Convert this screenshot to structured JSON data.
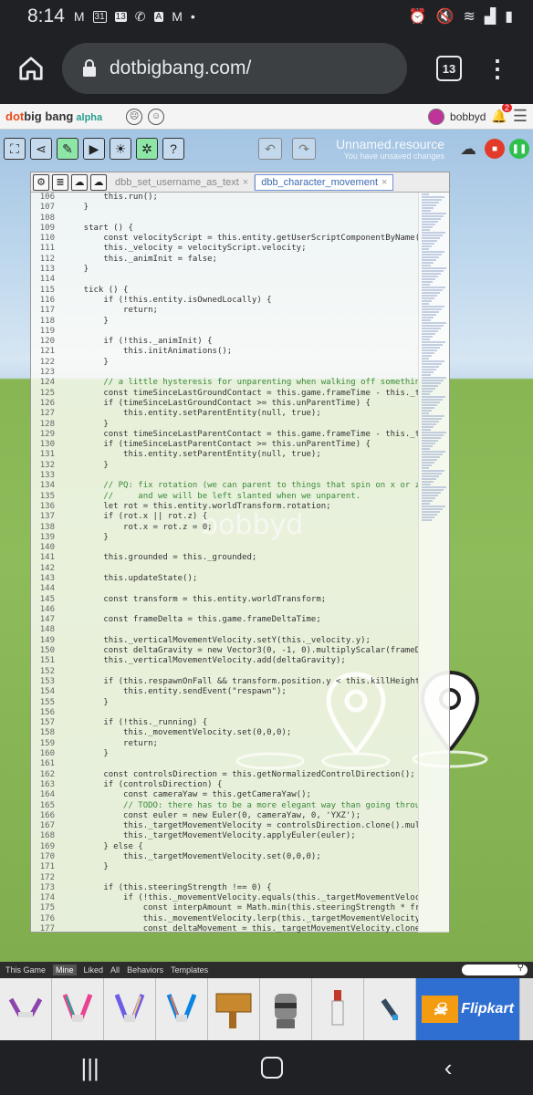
{
  "status": {
    "time": "8:14",
    "date_icon": "31",
    "cal2": "13"
  },
  "browser": {
    "url": "dotbigbang.com/",
    "tab_count": "13"
  },
  "app": {
    "logo_dot": "dot",
    "logo_main": "big bang",
    "logo_alpha": "alpha",
    "username": "bobbyd",
    "notif_count": "2",
    "resource_title": "Unnamed.resource",
    "resource_status": "You have unsaved changes"
  },
  "scene": {
    "player_label": "bobbyd"
  },
  "editor": {
    "tabs": [
      "dbb_set_username_as_text",
      "dbb_character_movement"
    ],
    "close_glyph": "×",
    "lines": [
      [
        "106",
        "        this.run();"
      ],
      [
        "107",
        "    }"
      ],
      [
        "108",
        ""
      ],
      [
        "109",
        "    start () {"
      ],
      [
        "110",
        "        const velocityScript = this.entity.getUserScriptComponentByName(\"dbb_"
      ],
      [
        "111",
        "        this._velocity = velocityScript.velocity;"
      ],
      [
        "112",
        "        this._animInit = false;"
      ],
      [
        "113",
        "    }"
      ],
      [
        "114",
        ""
      ],
      [
        "115",
        "    tick () {"
      ],
      [
        "116",
        "        if (!this.entity.isOwnedLocally) {"
      ],
      [
        "117",
        "            return;"
      ],
      [
        "118",
        "        }"
      ],
      [
        "119",
        ""
      ],
      [
        "120",
        "        if (!this._animInit) {"
      ],
      [
        "121",
        "            this.initAnimations();"
      ],
      [
        "122",
        "        }"
      ],
      [
        "123",
        ""
      ],
      [
        "124",
        "        // a little hysteresis for unparenting when walking off something to"
      ],
      [
        "125",
        "        const timeSinceLastGroundContact = this.game.frameTime - this._timeLa"
      ],
      [
        "126",
        "        if (timeSinceLastGroundContact >= this.unParentTime) {"
      ],
      [
        "127",
        "            this.entity.setParentEntity(null, true);"
      ],
      [
        "128",
        "        }"
      ],
      [
        "129",
        "        const timeSinceLastParentContact = this.game.frameTime - this._timeLa"
      ],
      [
        "130",
        "        if (timeSinceLastParentContact >= this.unParentTime) {"
      ],
      [
        "131",
        "            this.entity.setParentEntity(null, true);"
      ],
      [
        "132",
        "        }"
      ],
      [
        "133",
        ""
      ],
      [
        "134",
        "        // PQ: fix rotation (we can parent to things that spin on x or z, etc"
      ],
      [
        "135",
        "        //     and we will be left slanted when we unparent."
      ],
      [
        "136",
        "        let rot = this.entity.worldTransform.rotation;"
      ],
      [
        "137",
        "        if (rot.x || rot.z) {"
      ],
      [
        "138",
        "            rot.x = rot.z = 0;"
      ],
      [
        "139",
        "        }"
      ],
      [
        "140",
        ""
      ],
      [
        "141",
        "        this.grounded = this._grounded;"
      ],
      [
        "142",
        ""
      ],
      [
        "143",
        "        this.updateState();"
      ],
      [
        "144",
        ""
      ],
      [
        "145",
        "        const transform = this.entity.worldTransform;"
      ],
      [
        "146",
        ""
      ],
      [
        "147",
        "        const frameDelta = this.game.frameDeltaTime;"
      ],
      [
        "148",
        ""
      ],
      [
        "149",
        "        this._verticalMovementVelocity.setY(this._velocity.y);"
      ],
      [
        "150",
        "        const deltaGravity = new Vector3(0, -1, 0).multiplyScalar(frameDelta"
      ],
      [
        "151",
        "        this._verticalMovementVelocity.add(deltaGravity);"
      ],
      [
        "152",
        ""
      ],
      [
        "153",
        "        if (this.respawnOnFall && transform.position.y < this.killHeight) {"
      ],
      [
        "154",
        "            this.entity.sendEvent(\"respawn\");"
      ],
      [
        "155",
        "        }"
      ],
      [
        "156",
        ""
      ],
      [
        "157",
        "        if (!this._running) {"
      ],
      [
        "158",
        "            this._movementVelocity.set(0,0,0);"
      ],
      [
        "159",
        "            return;"
      ],
      [
        "160",
        "        }"
      ],
      [
        "161",
        ""
      ],
      [
        "162",
        "        const controlsDirection = this.getNormalizedControlDirection();"
      ],
      [
        "163",
        "        if (controlsDirection) {"
      ],
      [
        "164",
        "            const cameraYaw = this.getCameraYaw();"
      ],
      [
        "165",
        "            // TODO: there has to be a more elegant way than going through th"
      ],
      [
        "166",
        "            const euler = new Euler(0, cameraYaw, 0, 'YXZ');"
      ],
      [
        "167",
        "            this._targetMovementVelocity = controlsDirection.clone().multiply"
      ],
      [
        "168",
        "            this._targetMovementVelocity.applyEuler(euler);"
      ],
      [
        "169",
        "        } else {"
      ],
      [
        "170",
        "            this._targetMovementVelocity.set(0,0,0);"
      ],
      [
        "171",
        "        }"
      ],
      [
        "172",
        ""
      ],
      [
        "173",
        "        if (this.steeringStrength !== 0) {"
      ],
      [
        "174",
        "            if (!this._movementVelocity.equals(this._targetMovementVelocity))"
      ],
      [
        "175",
        "                const interpAmount = Math.min(this.steeringStrength * frameDe"
      ],
      [
        "176",
        "                this._movementVelocity.lerp(this._targetMovementVelocity, int"
      ],
      [
        "177",
        "                const deltaMovement = this._targetMovementVelocity.clone().su"
      ]
    ]
  },
  "asset_tabs": [
    "This Game",
    "Mine",
    "Liked",
    "All",
    "Behaviors",
    "Templates"
  ],
  "asset_active": "Mine",
  "flipkart": "Flipkart",
  "colors": {
    "stop": "#e23b2a",
    "play": "#2fbf4e",
    "accent": "#e94e1b"
  }
}
